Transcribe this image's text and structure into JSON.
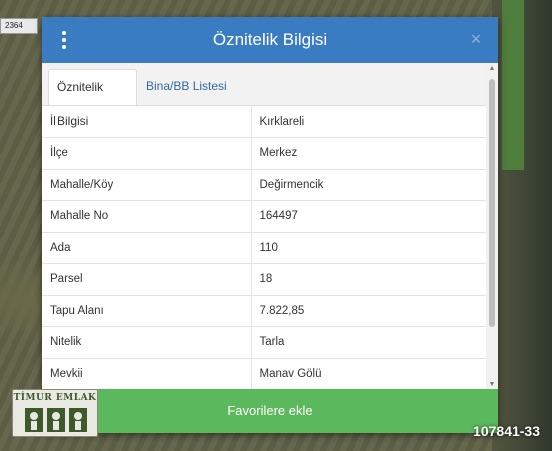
{
  "map": {
    "parcel_label": "2364"
  },
  "dialog": {
    "title": "Öznitelik Bilgisi",
    "close_glyph": "×"
  },
  "tabs": [
    {
      "label": "Öznitelik Bilgisi",
      "active": true
    },
    {
      "label": "Bina/BB Listesi",
      "active": false
    }
  ],
  "attributes": [
    {
      "key": "İl",
      "value": "Kırklareli"
    },
    {
      "key": "İlçe",
      "value": "Merkez"
    },
    {
      "key": "Mahalle/Köy",
      "value": "Değirmencik"
    },
    {
      "key": "Mahalle No",
      "value": "164497"
    },
    {
      "key": "Ada",
      "value": "110"
    },
    {
      "key": "Parsel",
      "value": "18"
    },
    {
      "key": "Tapu Alanı",
      "value": "7.822,85"
    },
    {
      "key": "Nitelik",
      "value": "Tarla"
    },
    {
      "key": "Mevkii",
      "value": "Manav Gölü"
    }
  ],
  "actions": {
    "favorite_label": "Favorilere ekle"
  },
  "watermark": {
    "logo_text": "TİMUR EMLAK",
    "listing_id": "107841-33"
  },
  "colors": {
    "header": "#3a7cc1",
    "favorite_button": "#5cb85c",
    "tab_link": "#2f6aa3"
  },
  "icons": {
    "menu": "kebab-menu-icon",
    "close": "close-icon",
    "scroll_up": "chevron-up-icon",
    "scroll_down": "chevron-down-icon"
  }
}
